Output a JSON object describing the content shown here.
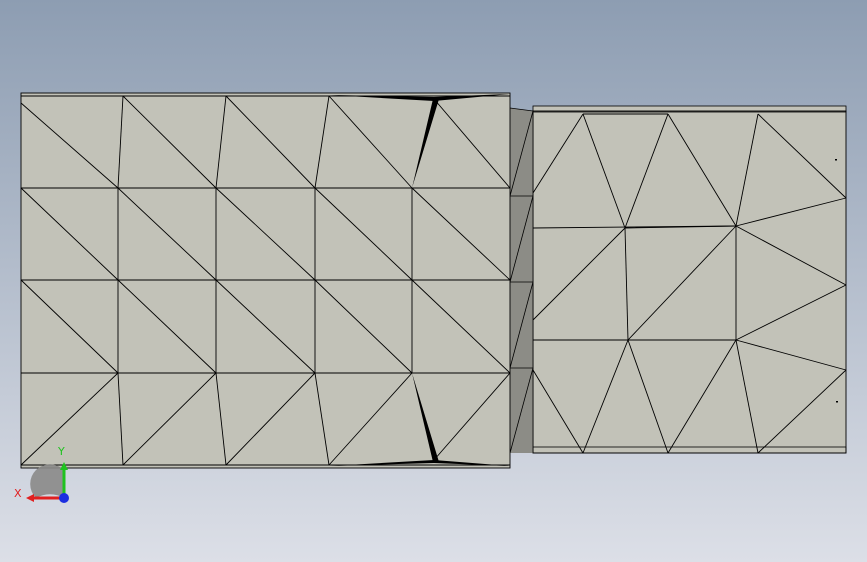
{
  "viewport": {
    "background_top": "#8d9db2",
    "background_bottom": "#dcdfe7"
  },
  "model": {
    "face_color": "#c2c2b8",
    "shadow_color": "#8c8c86",
    "edge_color": "#000000"
  },
  "triad": {
    "x_label": "X",
    "y_label": "Y",
    "x_color": "#e02020",
    "y_color": "#1fc21f",
    "z_color": "#1c2ee0",
    "base_color": "#8a8a88"
  }
}
